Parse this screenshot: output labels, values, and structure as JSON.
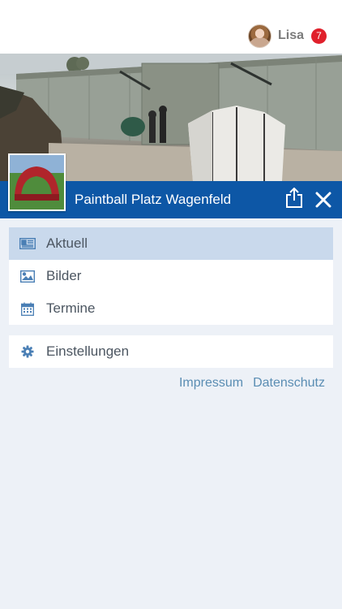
{
  "header": {
    "user_name": "Lisa",
    "notification_count": "7"
  },
  "venue": {
    "title": "Paintball Platz Wagenfeld"
  },
  "menu": {
    "items": [
      {
        "label": "Aktuell",
        "icon": "newspaper-icon",
        "active": true
      },
      {
        "label": "Bilder",
        "icon": "image-icon",
        "active": false
      },
      {
        "label": "Termine",
        "icon": "calendar-icon",
        "active": false
      }
    ],
    "settings": {
      "label": "Einstellungen",
      "icon": "gear-icon"
    }
  },
  "footer_links": {
    "impressum": "Impressum",
    "datenschutz": "Datenschutz"
  },
  "colors": {
    "title_bar": "#0d57a6",
    "active_item": "#c9d9ec",
    "icon_blue": "#4a7fb5",
    "badge": "#e0202b",
    "background": "#edf1f7"
  }
}
